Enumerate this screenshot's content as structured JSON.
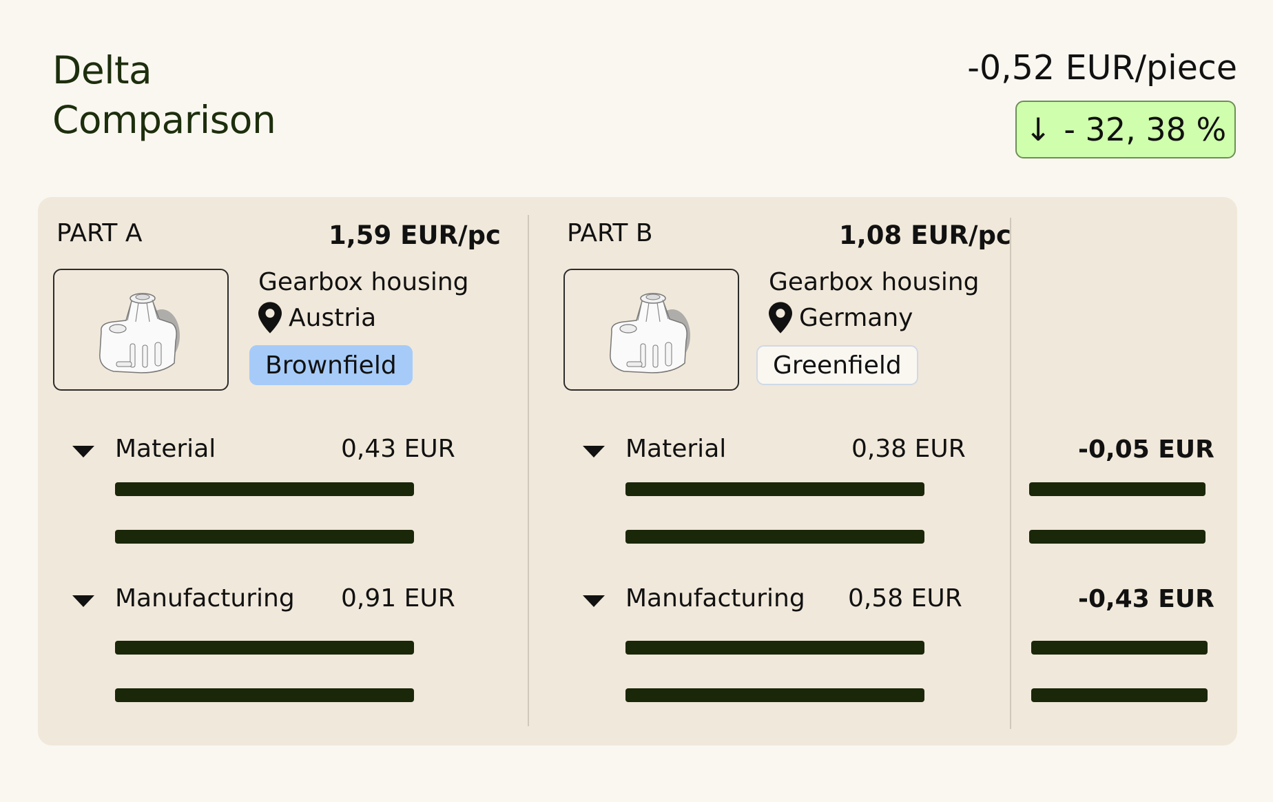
{
  "header": {
    "title_line1": "Delta",
    "title_line2": "Comparison",
    "delta_total": "-0,52 EUR/piece",
    "delta_percent": "- 32, 38 %",
    "arrow_icon": "arrow-down-icon"
  },
  "colors": {
    "background": "#faf7f1",
    "panel": "#f0e8da",
    "accent_dark": "#1a2709",
    "badge_green": "#cfffac",
    "brownfield_blue": "#a6cbf8"
  },
  "parts": [
    {
      "label": "PART A",
      "price": "1,59 EUR/pc",
      "name": "Gearbox housing",
      "location": "Austria",
      "tag": "Brownfield",
      "categories": [
        {
          "label": "Material",
          "value": "0,43 EUR"
        },
        {
          "label": "Manufacturing",
          "value": "0,91 EUR"
        }
      ]
    },
    {
      "label": "PART B",
      "price": "1,08 EUR/pc",
      "name": "Gearbox housing",
      "location": "Germany",
      "tag": "Greenfield",
      "categories": [
        {
          "label": "Material",
          "value": "0,38 EUR"
        },
        {
          "label": "Manufacturing",
          "value": "0,58 EUR"
        }
      ]
    }
  ],
  "deltas": [
    {
      "value": "-0,05 EUR"
    },
    {
      "value": "-0,43 EUR"
    }
  ]
}
